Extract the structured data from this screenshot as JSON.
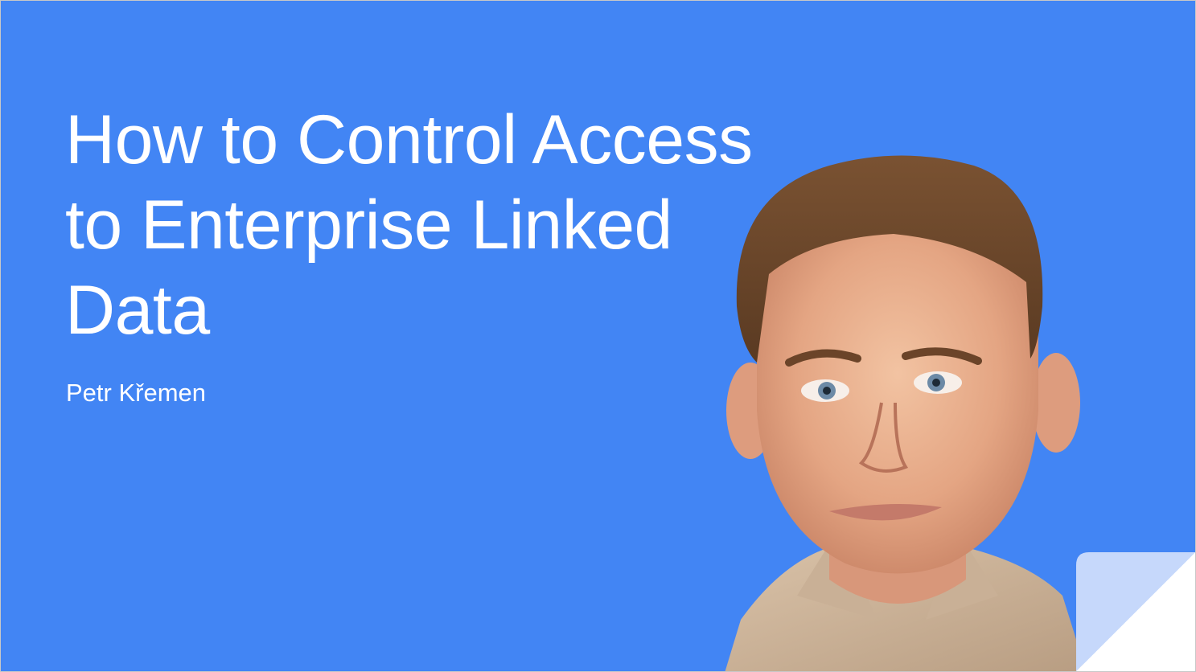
{
  "slide": {
    "title_lines": [
      "How to Control Access",
      "to Enterprise Linked",
      "Data"
    ],
    "author": "Petr Křemen"
  },
  "colors": {
    "background": "#4285f4",
    "text": "#ffffff",
    "corner_fold": "#c6d8fb"
  }
}
